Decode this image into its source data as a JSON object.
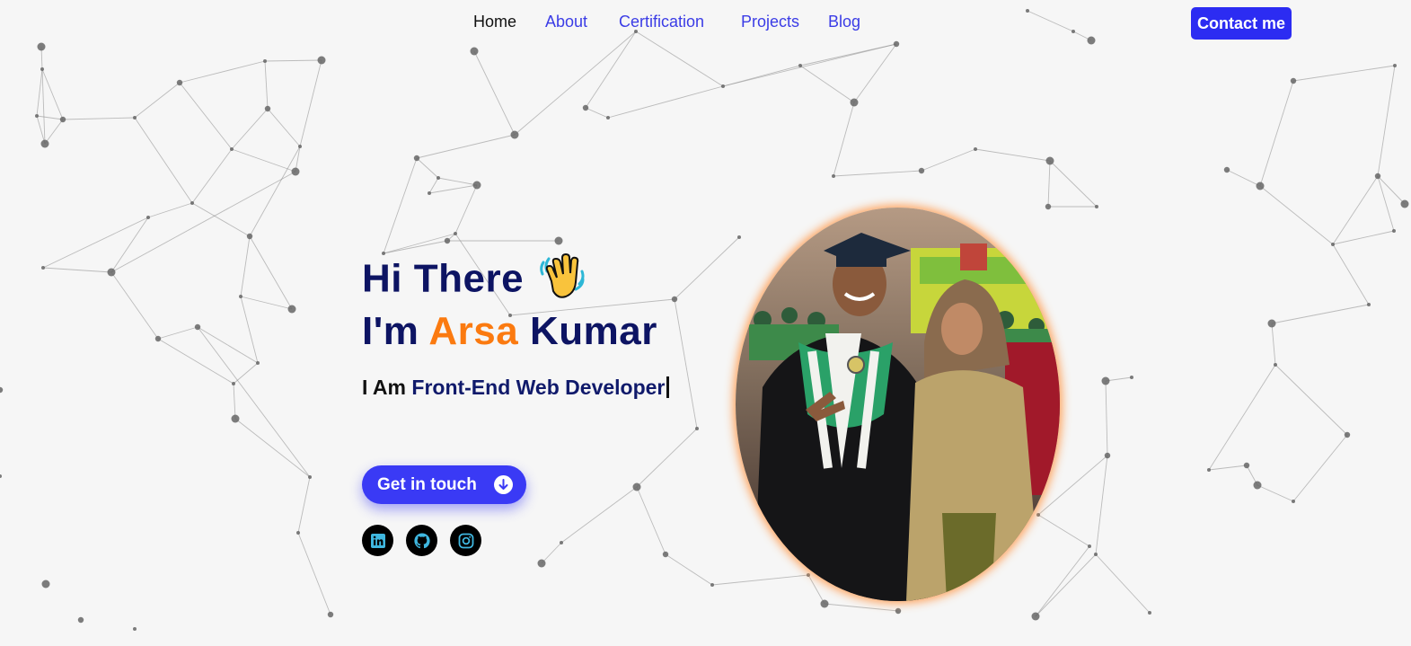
{
  "nav": {
    "links": [
      {
        "label": "Home",
        "active": true
      },
      {
        "label": "About",
        "active": false
      },
      {
        "label": "Certification",
        "active": false
      },
      {
        "label": "Projects",
        "active": false
      },
      {
        "label": "Blog",
        "active": false
      }
    ],
    "contact_label": "Contact me"
  },
  "hero": {
    "greeting": "Hi There",
    "greeting_icon": "waving-hand-icon",
    "intro": "I'm",
    "name_first": "Arsa",
    "name_last": "Kumar",
    "role_prefix": "I Am",
    "role_text": "Front-End Web Developer",
    "cta_label": "Get in touch",
    "cta_icon": "arrow-down-circle-icon"
  },
  "social": [
    {
      "name": "linkedin-icon"
    },
    {
      "name": "github-icon"
    },
    {
      "name": "instagram-icon"
    }
  ],
  "profile_photo": {
    "subject": "graduate-with-mother-photo"
  },
  "colors": {
    "background": "#f6f6f6",
    "primary": "#2c2cf2",
    "heading": "#0d1463",
    "accent": "#fb7a10",
    "nav_link": "#3b3ce6"
  }
}
